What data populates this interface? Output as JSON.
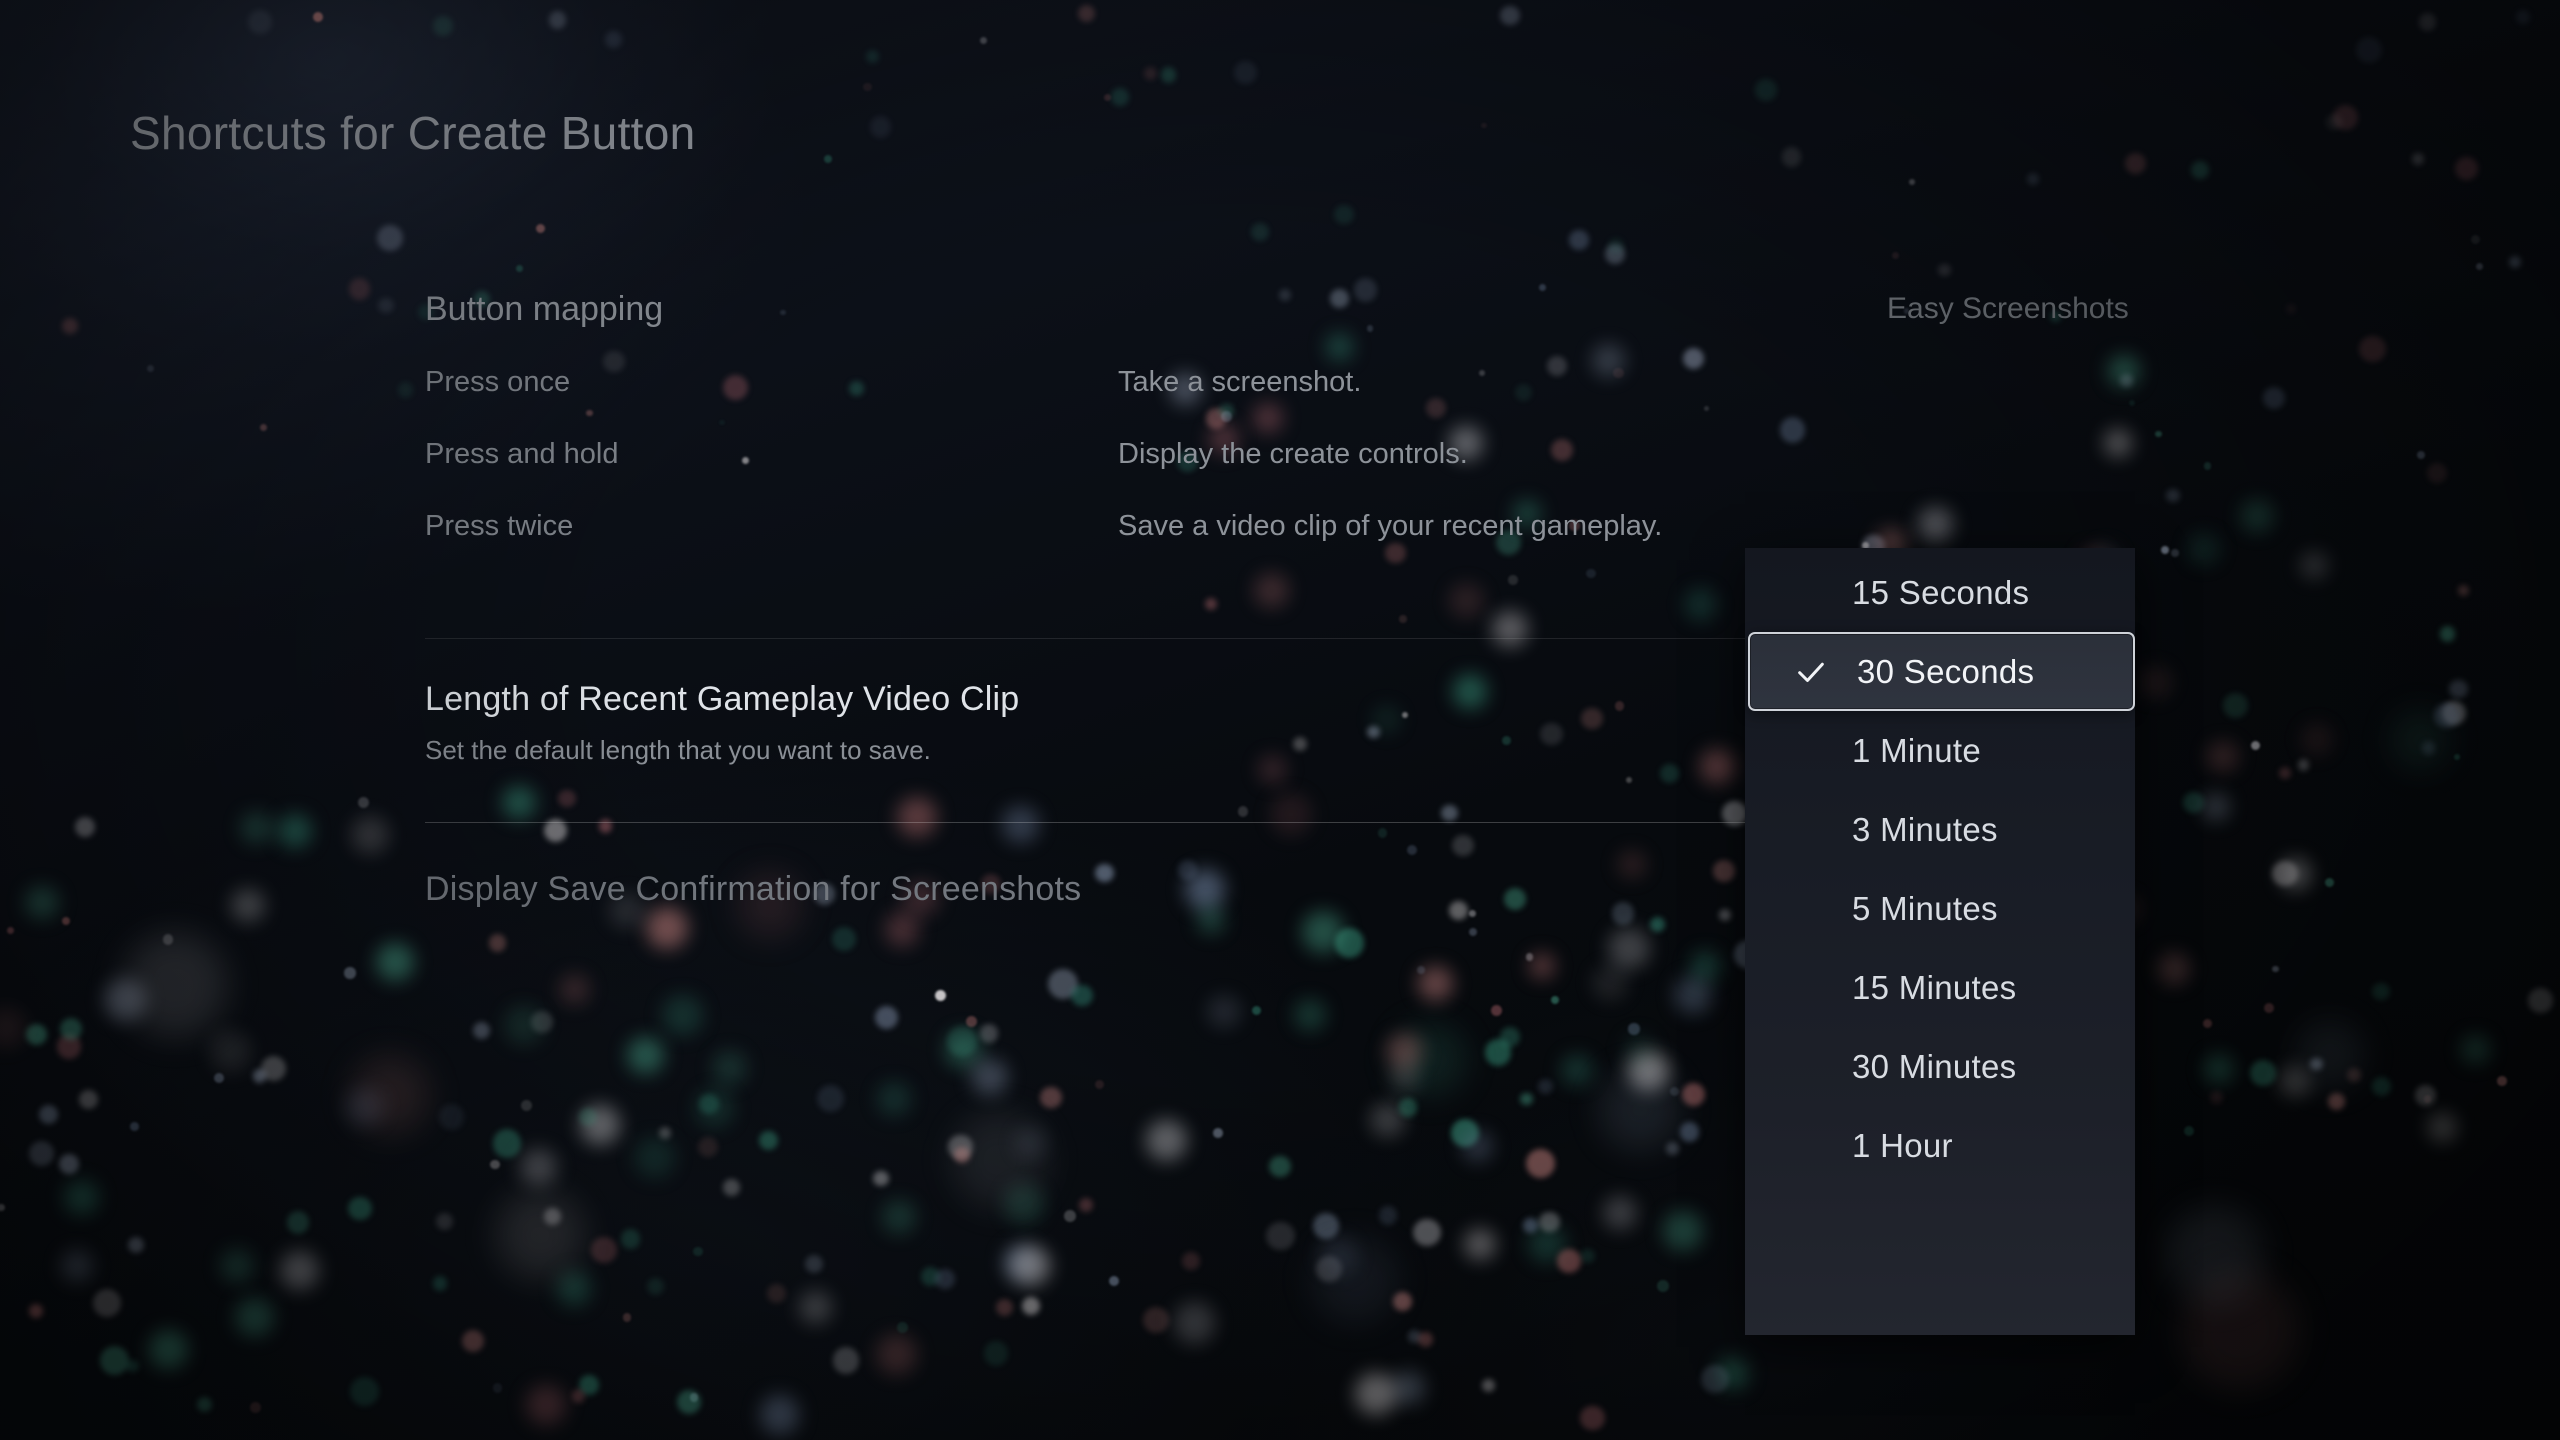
{
  "page": {
    "title": "Shortcuts for Create Button"
  },
  "button_mapping": {
    "header": "Button mapping",
    "preset": "Easy Screenshots",
    "rows": [
      {
        "key": "Press once",
        "value": "Take a screenshot."
      },
      {
        "key": "Press and hold",
        "value": "Display the create controls."
      },
      {
        "key": "Press twice",
        "value": "Save a video clip of your recent gameplay."
      }
    ]
  },
  "settings": [
    {
      "title": "Length of Recent Gameplay Video Clip",
      "subtitle": "Set the default length that you want to save.",
      "active": true
    },
    {
      "title": "Display Save Confirmation for Screenshots",
      "subtitle": "",
      "active": false
    }
  ],
  "dropdown": {
    "selected_value": "30 Seconds",
    "check_icon": "check-icon",
    "options": [
      {
        "label": "15 Seconds",
        "selected": false
      },
      {
        "label": "30 Seconds",
        "selected": true
      },
      {
        "label": "1 Minute",
        "selected": false
      },
      {
        "label": "3 Minutes",
        "selected": false
      },
      {
        "label": "5 Minutes",
        "selected": false
      },
      {
        "label": "15 Minutes",
        "selected": false
      },
      {
        "label": "30 Minutes",
        "selected": false
      },
      {
        "label": "1 Hour",
        "selected": false
      }
    ]
  },
  "colors": {
    "background": "#07090c",
    "title_text": "#9ba0a8",
    "primary_text": "#dfe3e8",
    "secondary_text": "#8a8f96",
    "dim_text": "#73787f",
    "panel_bg": "#181c25",
    "highlight_border": "#cfd3d9"
  }
}
